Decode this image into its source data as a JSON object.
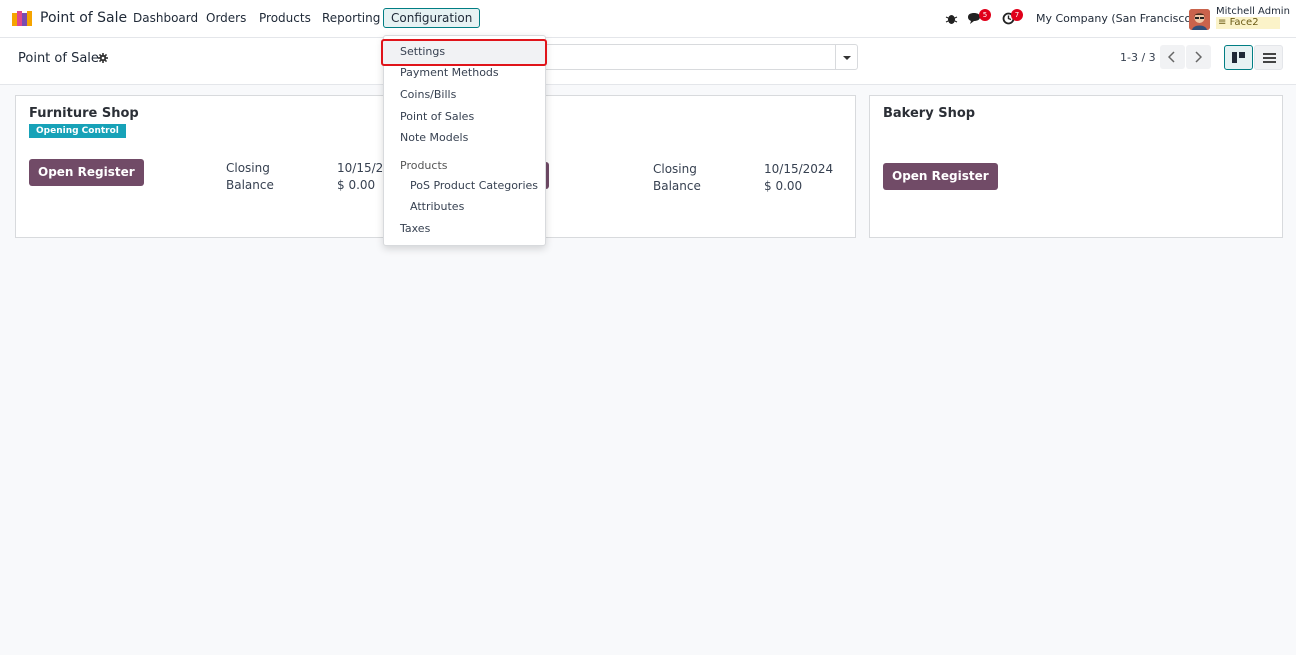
{
  "navbar": {
    "app_name": "Point of Sale",
    "menu": [
      "Dashboard",
      "Orders",
      "Products",
      "Reporting",
      "Configuration"
    ],
    "messages_badge": "5",
    "activities_badge": "7",
    "company": "My Company (San Francisco)",
    "user_name": "Mitchell Admin",
    "user_db": "Face2"
  },
  "control_panel": {
    "breadcrumb": "Point of Sale",
    "pager": "1-3 / 3"
  },
  "cards": [
    {
      "title": "Furniture Shop",
      "status": "Opening Control",
      "button": "Open Register",
      "closing_label": "Closing",
      "closing_value": "10/15/20",
      "balance_label": "Balance",
      "balance_value": "$ 0.00"
    },
    {
      "title": "",
      "button": "",
      "closing_label": "Closing",
      "closing_value": "10/15/2024",
      "balance_label": "Balance",
      "balance_value": "$ 0.00"
    },
    {
      "title": "Bakery Shop",
      "button": "Open Register"
    }
  ],
  "dropdown": {
    "items": {
      "settings": "Settings",
      "payment_methods": "Payment Methods",
      "coins_bills": "Coins/Bills",
      "point_of_sales": "Point of Sales",
      "note_models": "Note Models",
      "products_header": "Products",
      "pos_product_categories": "PoS Product Categories",
      "attributes": "Attributes",
      "taxes": "Taxes"
    }
  },
  "colors": {
    "brand": "#714b67",
    "accent": "#017e84",
    "status_tag": "#17a2b8",
    "highlight": "#e0141a",
    "badge": "#e0001a"
  }
}
